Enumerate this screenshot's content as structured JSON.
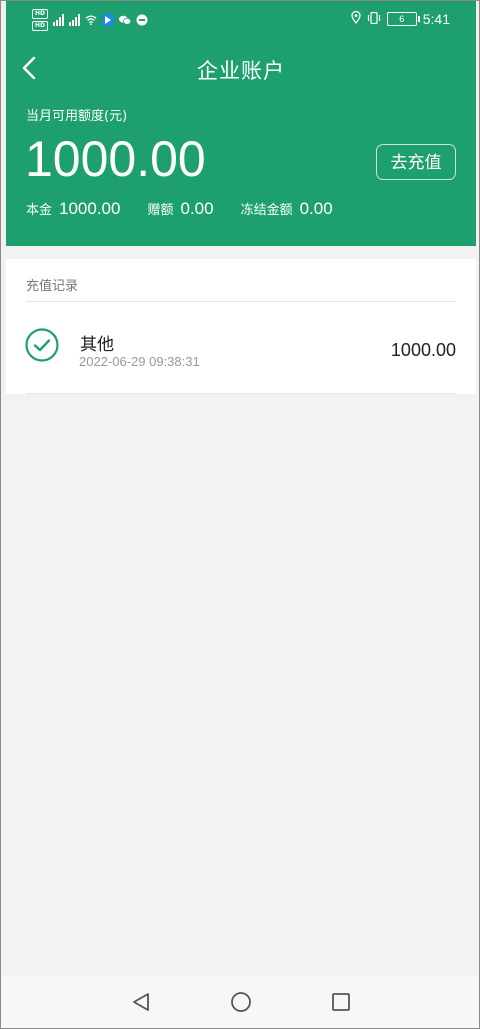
{
  "status_bar": {
    "hd_labels": [
      "HD",
      "HD"
    ],
    "battery_level": "6",
    "time": "5:41",
    "icons": [
      "signal-icon",
      "wifi-icon",
      "notification-icon",
      "wechat-icon",
      "message-icon",
      "location-icon",
      "vibrate-icon",
      "battery-icon"
    ]
  },
  "nav": {
    "title": "企业账户",
    "back_icon": "chevron-left-icon"
  },
  "account": {
    "quota_label": "当月可用额度(元)",
    "quota_value": "1000.00",
    "recharge_label": "去充值",
    "breakdown": [
      {
        "label": "本金",
        "value": "1000.00"
      },
      {
        "label": "赠额",
        "value": "0.00"
      },
      {
        "label": "冻结金额",
        "value": "0.00"
      }
    ]
  },
  "records": {
    "title": "充值记录",
    "items": [
      {
        "name": "其他",
        "time": "2022-06-29 09:38:31",
        "amount": "1000.00",
        "icon": "check-circle-icon"
      }
    ]
  },
  "system_nav": {
    "icons": [
      "back-triangle-icon",
      "home-circle-icon",
      "recents-square-icon"
    ]
  },
  "colors": {
    "brand_green": "#1ea06e",
    "background": "#f2f2f2",
    "text_dark": "#222222",
    "text_muted": "#999999"
  }
}
